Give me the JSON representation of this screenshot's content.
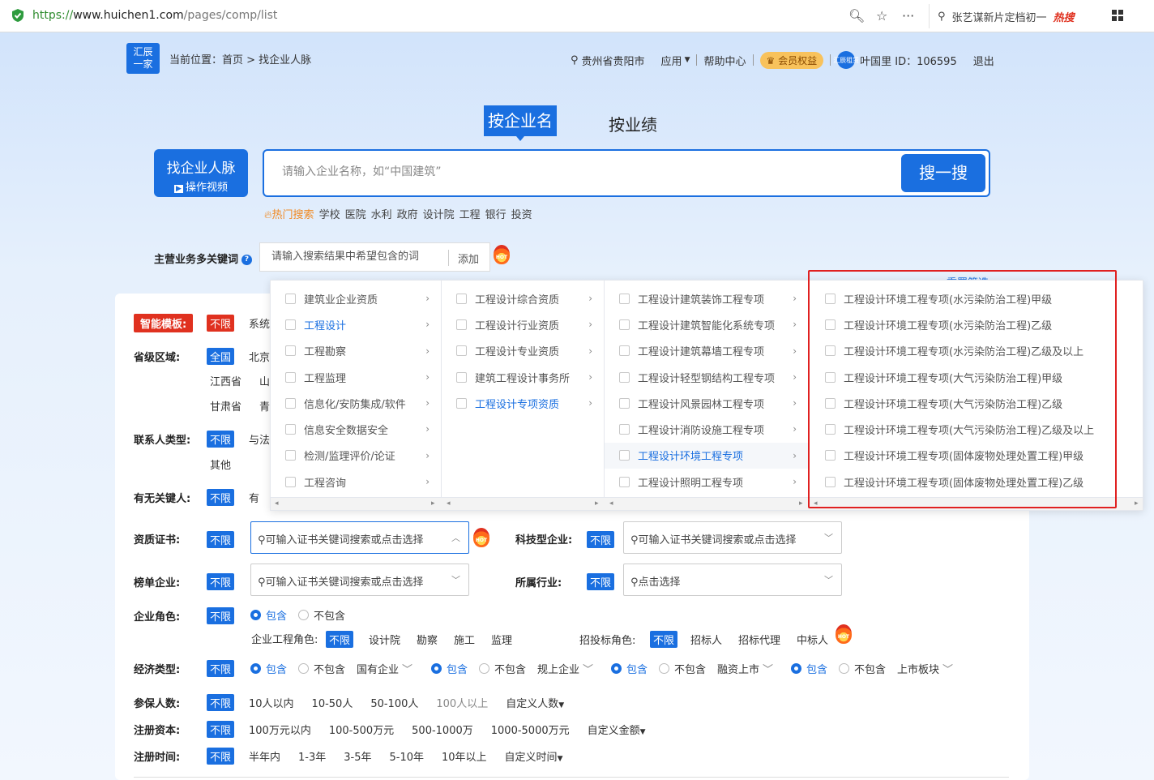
{
  "browser": {
    "url_scheme": "https://",
    "url_host": "www.huichen1.com",
    "url_path": "/pages/comp/list",
    "search_text": "张艺谋新片定档初一",
    "search_badge": "热搜"
  },
  "header": {
    "logo_line1": "汇辰",
    "logo_line2": "一家",
    "breadcrumb": "当前位置：首页 > 找企业人脉",
    "location": "贵州省贵阳市",
    "apps": "应用",
    "help": "帮助中心",
    "vip": "会员权益",
    "avatar_text": "汇辰租赁",
    "user": "叶国里 ID：106595",
    "logout": "退出"
  },
  "search": {
    "tab_active": "按企业名",
    "tab_other": "按业绩",
    "find_title": "找企业人脉",
    "find_sub": "操作视频",
    "placeholder": "请输入企业名称，如“中国建筑”",
    "button": "搜一搜",
    "hot_label": "热门搜索",
    "hot_words": [
      "学校",
      "医院",
      "水利",
      "政府",
      "设计院",
      "工程",
      "银行",
      "投资"
    ]
  },
  "keywords": {
    "label": "主营业务多关键词",
    "placeholder": "请输入搜索结果中希望包含的词",
    "add": "添加",
    "hot_badge": "HOT"
  },
  "filters": {
    "smart_template": "智能模板:",
    "unlimited": "不限",
    "system": "系统",
    "region_label": "省级区域:",
    "region_all": "全国",
    "region_beijing": "北京",
    "region_jiangxi": "江西省",
    "region_shan": "山",
    "region_gansu": "甘肃省",
    "region_qing": "青",
    "contact_label": "联系人类型:",
    "contact_yu": "与法",
    "contact_other": "其他",
    "keyperson_label": "有无关键人:",
    "keyperson_you": "有",
    "cert_label": "资质证书:",
    "cert_placeholder": "可输入证书关键词搜索或点击选择",
    "tech_label": "科技型企业:",
    "tech_placeholder": "可输入证书关键词搜索或点击选择",
    "rank_label": "榜单企业:",
    "rank_placeholder": "可输入证书关键词搜索或点击选择",
    "industry_label": "所属行业:",
    "industry_placeholder": "点击选择",
    "role_label": "企业角色:",
    "include": "包含",
    "exclude": "不包含",
    "eng_role_label": "企业工程角色:",
    "eng_roles": [
      "设计院",
      "勘察",
      "施工",
      "监理"
    ],
    "bid_role_label": "招投标角色:",
    "bid_roles": [
      "招标人",
      "招标代理",
      "中标人"
    ],
    "econ_label": "经济类型:",
    "econ_groups": [
      "国有企业",
      "规上企业",
      "融资上市",
      "上市板块"
    ],
    "staff_label": "参保人数:",
    "staff_opts": [
      "10人以内",
      "10-50人",
      "50-100人",
      "100人以上"
    ],
    "staff_custom": "自定义人数",
    "capital_label": "注册资本:",
    "capital_opts": [
      "100万元以内",
      "100-500万元",
      "500-1000万",
      "1000-5000万元"
    ],
    "capital_custom": "自定义金额",
    "time_label": "注册时间:",
    "time_opts": [
      "半年内",
      "1-3年",
      "3-5年",
      "5-10年",
      "10年以上"
    ],
    "time_custom": "自定义时间"
  },
  "cascade": {
    "reset_link": "重置筛选",
    "col1": [
      "建筑业企业资质",
      "工程设计",
      "工程勘察",
      "工程监理",
      "信息化/安防集成/软件",
      "信息安全数据安全",
      "检测/监理评价/论证",
      "工程咨询"
    ],
    "col2": [
      "工程设计综合资质",
      "工程设计行业资质",
      "工程设计专业资质",
      "建筑工程设计事务所",
      "工程设计专项资质"
    ],
    "col3": [
      "工程设计建筑装饰工程专项",
      "工程设计建筑智能化系统专项",
      "工程设计建筑幕墙工程专项",
      "工程设计轻型钢结构工程专项",
      "工程设计风景园林工程专项",
      "工程设计消防设施工程专项",
      "工程设计环境工程专项",
      "工程设计照明工程专项"
    ],
    "col4": [
      "工程设计环境工程专项(水污染防治工程)甲级",
      "工程设计环境工程专项(水污染防治工程)乙级",
      "工程设计环境工程专项(水污染防治工程)乙级及以上",
      "工程设计环境工程专项(大气污染防治工程)甲级",
      "工程设计环境工程专项(大气污染防治工程)乙级",
      "工程设计环境工程专项(大气污染防治工程)乙级及以上",
      "工程设计环境工程专项(固体废物处理处置工程)甲级",
      "工程设计环境工程专项(固体废物处理处置工程)乙级"
    ]
  },
  "colors": {
    "primary": "#1a6fe0",
    "danger": "#e02020",
    "vip": "#f8c25c"
  }
}
